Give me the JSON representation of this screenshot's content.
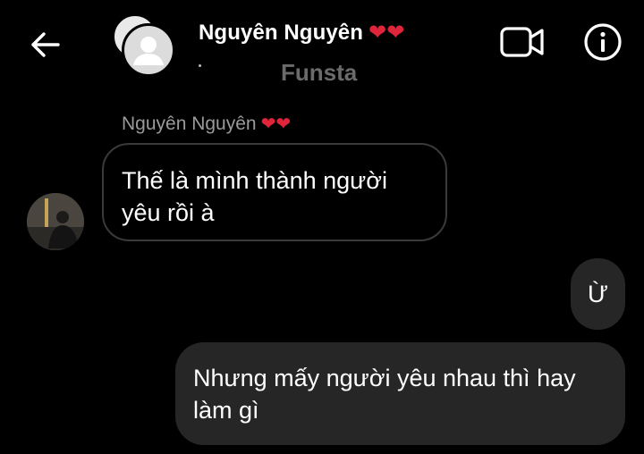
{
  "header": {
    "contact_name": "Nguyên Nguyên",
    "name_hearts": "❤❤",
    "subtitle": "Funsta"
  },
  "icons": {
    "back": "back-arrow-icon",
    "video": "video-camera-icon",
    "info": "info-icon"
  },
  "conversation": {
    "sender_name": "Nguyên Nguyên",
    "sender_hearts": "❤❤",
    "messages": [
      {
        "direction": "incoming",
        "text": "Thế là mình thành người yêu rồi à"
      },
      {
        "direction": "outgoing",
        "text": "Ừ"
      },
      {
        "direction": "outgoing",
        "text": "Nhưng mấy người yêu nhau thì hay làm gì"
      }
    ]
  },
  "colors": {
    "background": "#000000",
    "outgoing_bubble": "#262626",
    "incoming_border": "#3a3a3a",
    "heart": "#e0243a",
    "muted_text": "#9a9a9a"
  }
}
